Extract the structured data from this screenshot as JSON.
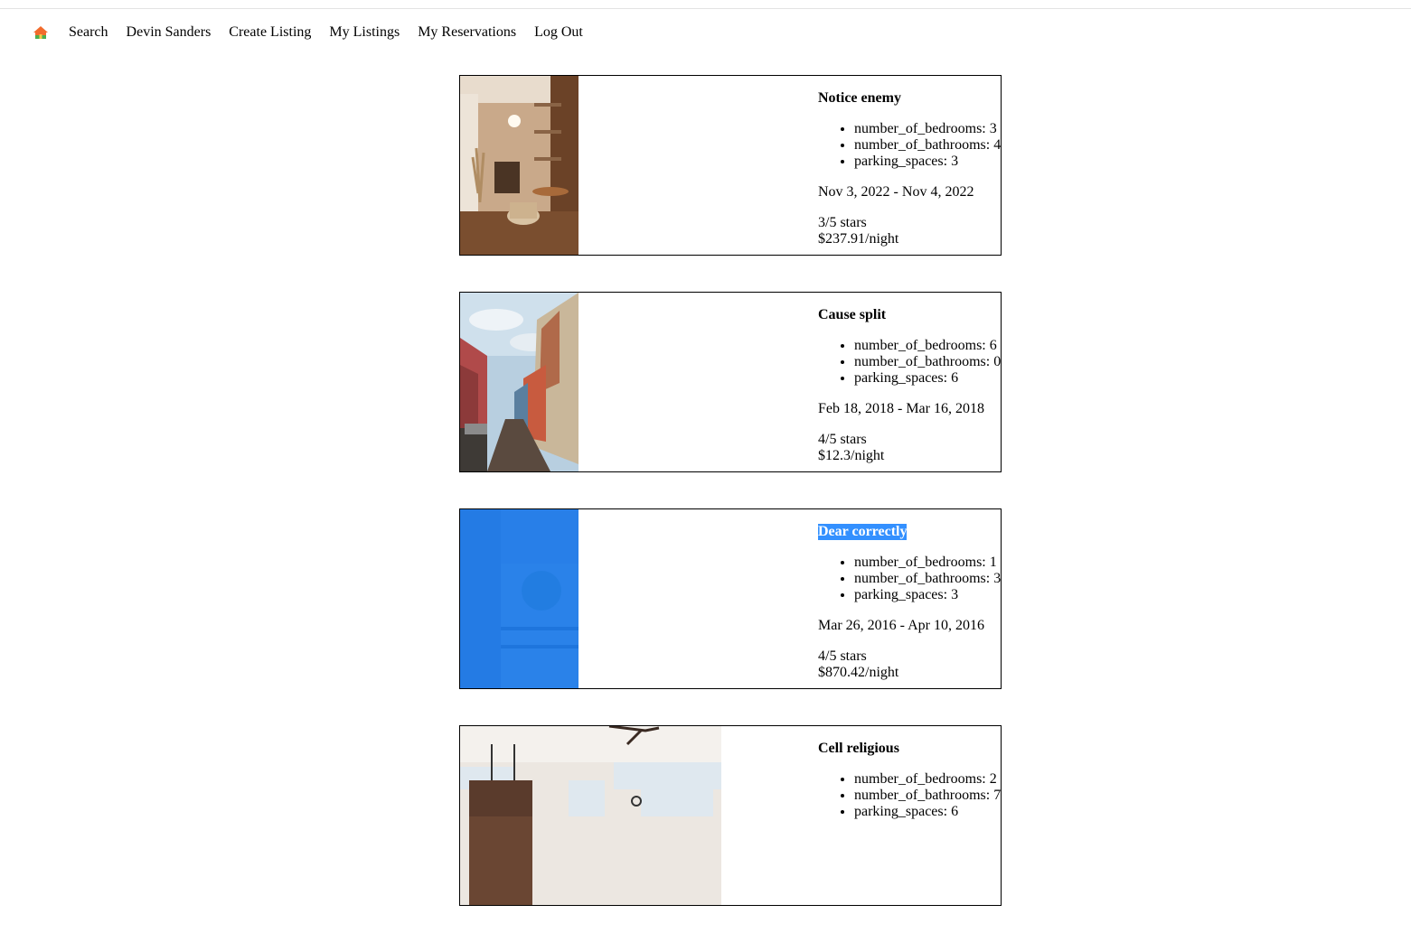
{
  "nav": {
    "home_icon": "home-icon",
    "links": [
      {
        "label": "Search"
      },
      {
        "label": "Devin Sanders"
      },
      {
        "label": "Create Listing"
      },
      {
        "label": "My Listings"
      },
      {
        "label": "My Reservations"
      },
      {
        "label": "Log Out"
      }
    ]
  },
  "listings": [
    {
      "title": "Notice enemy",
      "features": [
        "number_of_bedrooms: 3",
        "number_of_bathrooms: 4",
        "parking_spaces: 3"
      ],
      "dates": "Nov 3, 2022 - Nov 4, 2022",
      "rating": "3/5 stars",
      "price": "$237.91/night"
    },
    {
      "title": "Cause split",
      "features": [
        "number_of_bedrooms: 6",
        "number_of_bathrooms: 0",
        "parking_spaces: 6"
      ],
      "dates": "Feb 18, 2018 - Mar 16, 2018",
      "rating": "4/5 stars",
      "price": "$12.3/night"
    },
    {
      "title": "Dear correctly",
      "features": [
        "number_of_bedrooms: 1",
        "number_of_bathrooms: 3",
        "parking_spaces: 3"
      ],
      "dates": "Mar 26, 2016 - Apr 10, 2016",
      "rating": "4/5 stars",
      "price": "$870.42/night"
    },
    {
      "title": "Cell religious",
      "features": [
        "number_of_bedrooms: 2",
        "number_of_bathrooms: 7",
        "parking_spaces: 6"
      ],
      "dates": "",
      "rating": "",
      "price": ""
    }
  ],
  "colors": {
    "selection": "#3390ff",
    "border": "#000000"
  }
}
